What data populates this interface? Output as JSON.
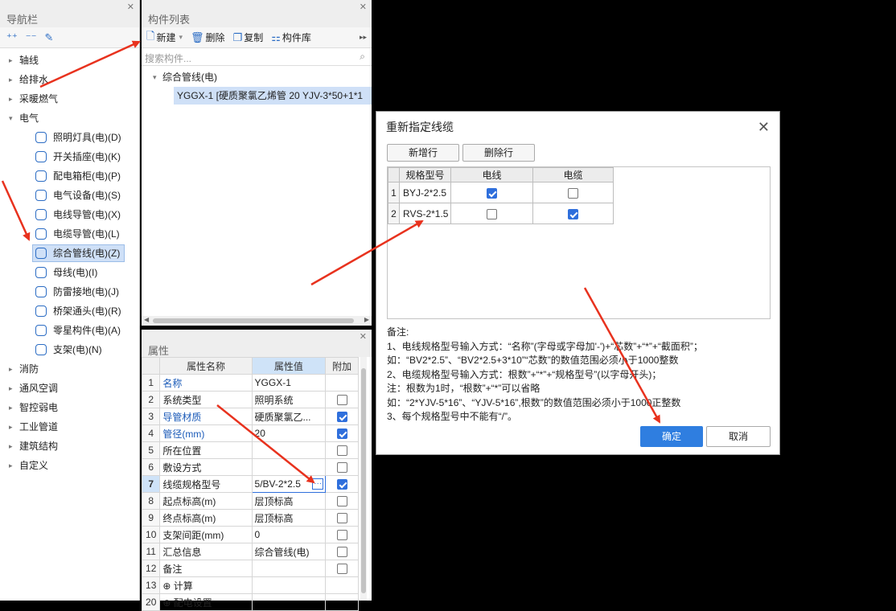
{
  "nav": {
    "title": "导航栏",
    "tools": [
      "+",
      "-",
      "✎"
    ],
    "items": [
      {
        "label": "轴线",
        "expanded": false
      },
      {
        "label": "给排水",
        "expanded": false
      },
      {
        "label": "采暖燃气",
        "expanded": false
      },
      {
        "label": "电气",
        "expanded": true
      }
    ],
    "electric_children": [
      {
        "label": "照明灯具(电)(D)",
        "icon": "bulb-icon"
      },
      {
        "label": "开关插座(电)(K)",
        "icon": "switch-icon"
      },
      {
        "label": "配电箱柜(电)(P)",
        "icon": "panel-icon"
      },
      {
        "label": "电气设备(电)(S)",
        "icon": "plug-icon"
      },
      {
        "label": "电线导管(电)(X)",
        "icon": "conduit-icon"
      },
      {
        "label": "电缆导管(电)(L)",
        "icon": "cable-conduit-icon"
      },
      {
        "label": "综合管线(电)(Z)",
        "icon": "combined-pipe-icon",
        "selected": true
      },
      {
        "label": "母线(电)(I)",
        "icon": "busbar-icon"
      },
      {
        "label": "防雷接地(电)(J)",
        "icon": "grounding-icon"
      },
      {
        "label": "桥架通头(电)(R)",
        "icon": "tray-icon"
      },
      {
        "label": "零星构件(电)(A)",
        "icon": "grid-icon"
      },
      {
        "label": "支架(电)(N)",
        "icon": "bracket-icon"
      }
    ],
    "items_after": [
      {
        "label": "消防"
      },
      {
        "label": "通风空调"
      },
      {
        "label": "智控弱电"
      },
      {
        "label": "工业管道"
      },
      {
        "label": "建筑结构"
      },
      {
        "label": "自定义"
      }
    ]
  },
  "component_list": {
    "title": "构件列表",
    "tools": {
      "new": "新建",
      "delete": "删除",
      "copy": "复制",
      "library": "构件库"
    },
    "search_placeholder": "搜索构件...",
    "group": "综合管线(电)",
    "item": "YGGX-1 [硬质聚氯乙烯管 20 YJV-3*50+1*1"
  },
  "properties": {
    "title": "属性",
    "headers": [
      "属性名称",
      "属性值",
      "附加"
    ],
    "rows": [
      {
        "n": "1",
        "name": "名称",
        "value": "YGGX-1",
        "blue": true,
        "check": null
      },
      {
        "n": "2",
        "name": "系统类型",
        "value": "照明系统",
        "blue": false,
        "check": false
      },
      {
        "n": "3",
        "name": "导管材质",
        "value": "硬质聚氯乙...",
        "blue": true,
        "check": true
      },
      {
        "n": "4",
        "name": "管径(mm)",
        "value": "20",
        "blue": true,
        "check": true
      },
      {
        "n": "5",
        "name": "所在位置",
        "value": "",
        "blue": false,
        "check": false
      },
      {
        "n": "6",
        "name": "敷设方式",
        "value": "",
        "blue": false,
        "check": false
      },
      {
        "n": "7",
        "name": "线缆规格型号",
        "value": "5/BV-2*2.5",
        "blue": false,
        "check": true,
        "selected": true
      },
      {
        "n": "8",
        "name": "起点标高(m)",
        "value": "层顶标高",
        "blue": false,
        "check": false
      },
      {
        "n": "9",
        "name": "终点标高(m)",
        "value": "层顶标高",
        "blue": false,
        "check": false
      },
      {
        "n": "10",
        "name": "支架间距(mm)",
        "value": "0",
        "blue": false,
        "check": false
      },
      {
        "n": "11",
        "name": "汇总信息",
        "value": "综合管线(电)",
        "blue": false,
        "check": false
      },
      {
        "n": "12",
        "name": "备注",
        "value": "",
        "blue": false,
        "check": false
      },
      {
        "n": "13",
        "name": "⊕ 计算",
        "value": "",
        "blue": false,
        "check": null
      },
      {
        "n": "20",
        "name": "⊕ 配电设置",
        "value": "",
        "blue": false,
        "check": null
      }
    ]
  },
  "dialog": {
    "title": "重新指定线缆",
    "add_row": "新增行",
    "delete_row": "删除行",
    "headers": [
      "规格型号",
      "电线",
      "电缆"
    ],
    "rows": [
      {
        "n": "1",
        "spec": "BYJ-2*2.5",
        "wire": true,
        "cable": false
      },
      {
        "n": "2",
        "spec": "RVS-2*1.5",
        "wire": false,
        "cable": true
      }
    ],
    "notes": [
      "备注:",
      "1、电线规格型号输入方式：“名称”(字母或字母加'-')+“芯数”+“*”+“截面积”；",
      "如：“BV2*2.5”、“BV2*2.5+3*10”“芯数”的数值范围必须小于1000整数",
      "2、电缆规格型号输入方式：根数”+“*”+“规格型号”(以字母开头)；",
      "注：根数为1时，“根数”+“*”可以省略",
      "如：“2*YJV-5*16”、“YJV-5*16”,根数”的数值范围必须小于1000正整数",
      "3、每个规格型号中不能有“/”。"
    ],
    "ok": "确定",
    "cancel": "取消"
  },
  "colors": {
    "accent": "#2f7ee0",
    "arrow": "#e8321e",
    "selection": "#cfe0f7"
  }
}
